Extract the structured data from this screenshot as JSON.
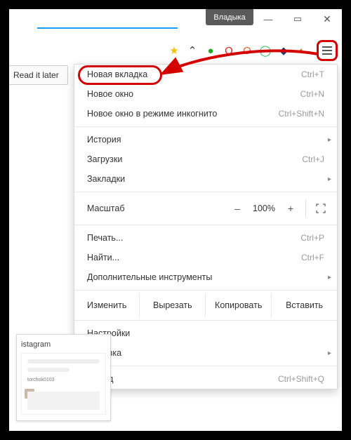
{
  "window": {
    "title": "Владыка",
    "controls": {
      "min": "—",
      "max": "▭",
      "close": "✕"
    }
  },
  "toolbar": {
    "read_later": "Read it later",
    "icons": {
      "star": "★",
      "pocket": "⌃",
      "evernote": "●",
      "opera": "O",
      "origin": "O",
      "chrome": "◯",
      "dashlane": "◆",
      "avast": "◐"
    }
  },
  "menu": {
    "new_tab": {
      "label": "Новая вкладка",
      "shortcut": "Ctrl+T"
    },
    "new_window": {
      "label": "Новое окно",
      "shortcut": "Ctrl+N"
    },
    "incognito": {
      "label": "Новое окно в режиме инкогнито",
      "shortcut": "Ctrl+Shift+N"
    },
    "history": {
      "label": "История"
    },
    "downloads": {
      "label": "Загрузки",
      "shortcut": "Ctrl+J"
    },
    "bookmarks": {
      "label": "Закладки"
    },
    "zoom": {
      "label": "Масштаб",
      "minus": "–",
      "value": "100%",
      "plus": "+"
    },
    "print": {
      "label": "Печать...",
      "shortcut": "Ctrl+P"
    },
    "find": {
      "label": "Найти...",
      "shortcut": "Ctrl+F"
    },
    "more_tools": {
      "label": "Дополнительные инструменты"
    },
    "edit": {
      "label": "Изменить",
      "cut": "Вырезать",
      "copy": "Копировать",
      "paste": "Вставить"
    },
    "settings": {
      "label": "Настройки"
    },
    "help": {
      "label": "Справка"
    },
    "exit": {
      "label": "Выход",
      "shortcut": "Ctrl+Shift+Q"
    }
  },
  "thumbnail": {
    "title": "istagram",
    "username": "torchok0103"
  },
  "colors": {
    "annotation": "#d40000"
  }
}
